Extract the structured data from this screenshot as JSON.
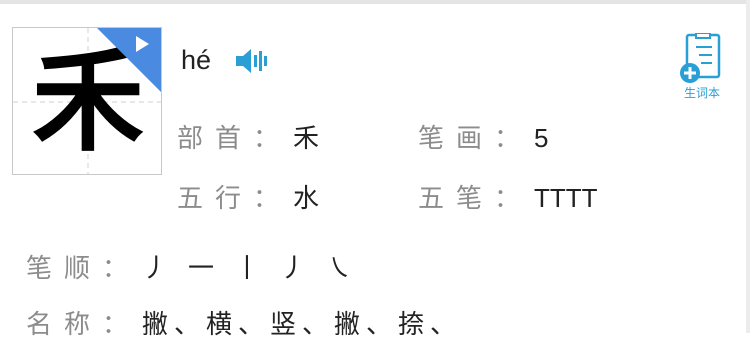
{
  "character": "禾",
  "pinyin": "hé",
  "vocab_label": "生词本",
  "radical": {
    "label": "部首",
    "value": "禾"
  },
  "strokes_count": {
    "label": "笔画",
    "value": "5"
  },
  "wuxing": {
    "label": "五行",
    "value": "水"
  },
  "wubi": {
    "label": "五笔",
    "value": "TTTT"
  },
  "stroke_order": {
    "label": "笔顺",
    "glyphs": [
      "丿",
      "一",
      "丨",
      "丿",
      "㇏"
    ]
  },
  "stroke_names": {
    "label": "名称",
    "text": "撇、横、竖、撇、捺、"
  },
  "colon": "：",
  "colors": {
    "accent_blue": "#4a8ae0",
    "icon_blue": "#2a9fd6"
  },
  "icons": [
    "play-triangle-icon",
    "speaker-icon",
    "vocabulary-book-icon"
  ]
}
